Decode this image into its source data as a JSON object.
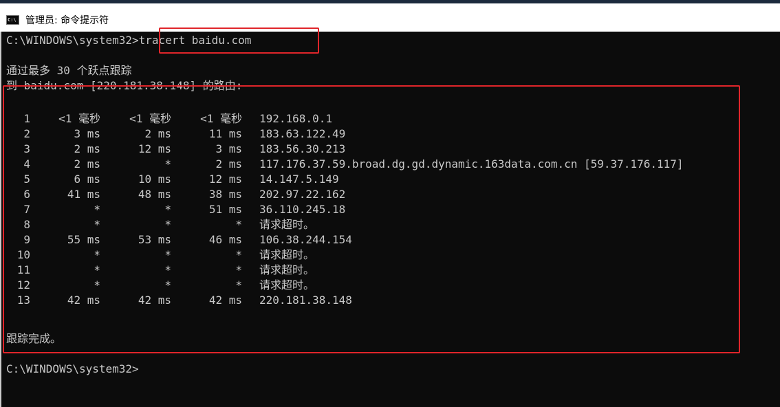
{
  "window": {
    "title": "管理员: 命令提示符",
    "icon": "cmd-icon",
    "icon_text": "C:\\"
  },
  "console": {
    "command_prompt": "C:\\WINDOWS\\system32>",
    "command": "tracert baidu.com",
    "header_line1": "通过最多 30 个跃点跟踪",
    "header_line2": "到 baidu.com [220.181.38.148] 的路由:",
    "hops": [
      {
        "n": "1",
        "t1": "<1 毫秒",
        "t2": "<1 毫秒",
        "t3": "<1 毫秒",
        "host": "192.168.0.1"
      },
      {
        "n": "2",
        "t1": "3 ms",
        "t2": "2 ms",
        "t3": "11 ms",
        "host": "183.63.122.49"
      },
      {
        "n": "3",
        "t1": "2 ms",
        "t2": "12 ms",
        "t3": "3 ms",
        "host": "183.56.30.213"
      },
      {
        "n": "4",
        "t1": "2 ms",
        "t2": "*",
        "t3": "2 ms",
        "host": "117.176.37.59.broad.dg.gd.dynamic.163data.com.cn [59.37.176.117]"
      },
      {
        "n": "5",
        "t1": "6 ms",
        "t2": "10 ms",
        "t3": "12 ms",
        "host": "14.147.5.149"
      },
      {
        "n": "6",
        "t1": "41 ms",
        "t2": "48 ms",
        "t3": "38 ms",
        "host": "202.97.22.162"
      },
      {
        "n": "7",
        "t1": "*",
        "t2": "*",
        "t3": "51 ms",
        "host": "36.110.245.18"
      },
      {
        "n": "8",
        "t1": "*",
        "t2": "*",
        "t3": "*",
        "host": "请求超时。"
      },
      {
        "n": "9",
        "t1": "55 ms",
        "t2": "53 ms",
        "t3": "46 ms",
        "host": "106.38.244.154"
      },
      {
        "n": "10",
        "t1": "*",
        "t2": "*",
        "t3": "*",
        "host": "请求超时。"
      },
      {
        "n": "11",
        "t1": "*",
        "t2": "*",
        "t3": "*",
        "host": "请求超时。"
      },
      {
        "n": "12",
        "t1": "*",
        "t2": "*",
        "t3": "*",
        "host": "请求超时。"
      },
      {
        "n": "13",
        "t1": "42 ms",
        "t2": "42 ms",
        "t3": "42 ms",
        "host": "220.181.38.148"
      }
    ],
    "complete": "跟踪完成。",
    "final_prompt": "C:\\WINDOWS\\system32>"
  },
  "annotations": {
    "color": "#e0252a"
  }
}
